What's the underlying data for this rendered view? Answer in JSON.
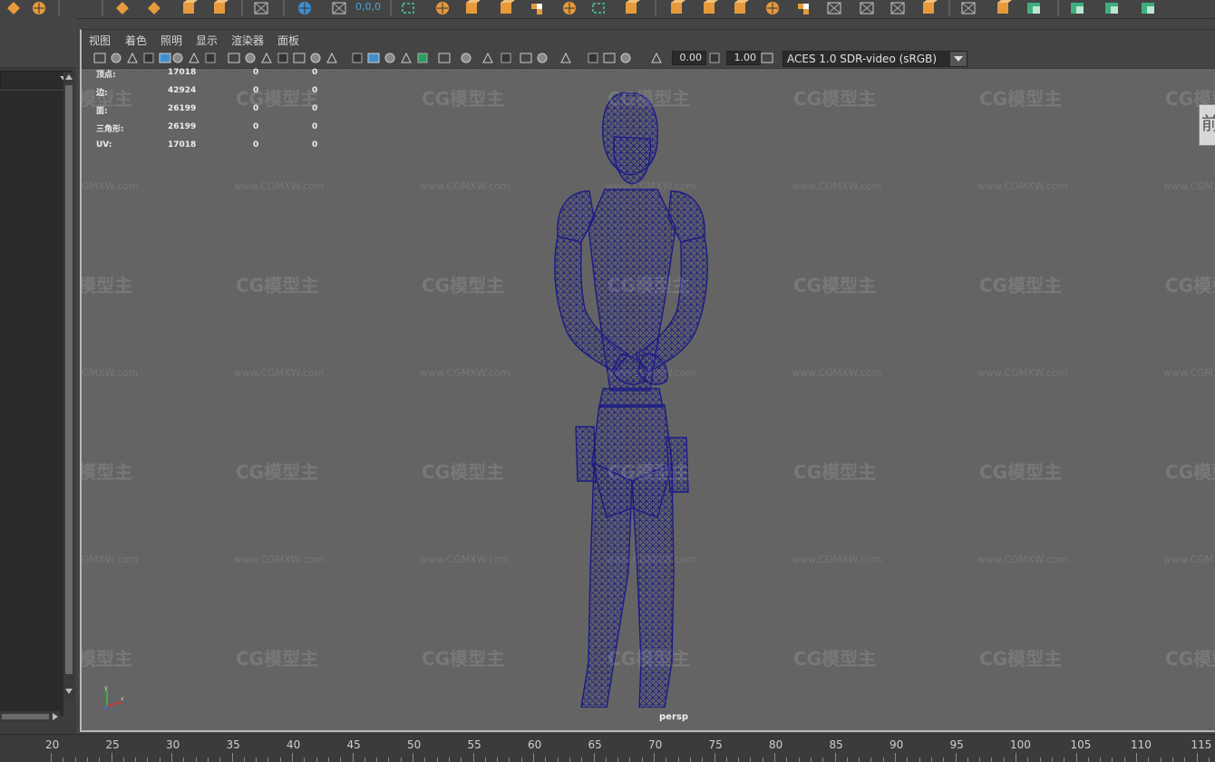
{
  "shelf": {
    "coords_readout": "0,0,0",
    "icons": [
      "diamond-shape-icon",
      "globe-shape-icon",
      "arrows-move-icon",
      "select-arrows-icon",
      "text-tool-icon",
      "picture-tool-icon",
      "grid-display-icon",
      "anchor-target-icon",
      "delete-x-icon",
      "lasso-select-icon",
      "render-sphere-icon",
      "cube-shape-icon",
      "cube-split-icon",
      "checker-cube-icon",
      "sphere-wire-icon",
      "edge-bracket-icon",
      "box-create-icon",
      "orange-block-icon",
      "cube-extrude-icon",
      "cube-bevel-icon",
      "texture-ball-icon",
      "uv-box-icon",
      "mirror-plane-icon",
      "triangle-mesh-icon",
      "mesh-cleanup-icon",
      "paint-brush-icon",
      "crop-box-icon",
      "sculpt-pen-icon",
      "green-shape-icon",
      "green-cylinder-icon",
      "green-cube-icon",
      "green-merge-icon"
    ]
  },
  "viewport": {
    "menu": [
      "视图",
      "着色",
      "照明",
      "显示",
      "渲染器",
      "面板"
    ],
    "toolbar": {
      "exposure_value": "0.00",
      "gamma_value": "1.00",
      "color_management": "ACES 1.0 SDR-video (sRGB)"
    },
    "hud": [
      {
        "label": "顶点:",
        "v1": "17018",
        "v2": "0",
        "v3": "0"
      },
      {
        "label": "边:",
        "v1": "42924",
        "v2": "0",
        "v3": "0"
      },
      {
        "label": "面:",
        "v1": "26199",
        "v2": "0",
        "v3": "0"
      },
      {
        "label": "三角形:",
        "v1": "26199",
        "v2": "0",
        "v3": "0"
      },
      {
        "label": "UV:",
        "v1": "17018",
        "v2": "0",
        "v3": "0"
      }
    ],
    "camera": "persp",
    "view_cube_text": "前",
    "axis": {
      "y": "y",
      "x": "x"
    }
  },
  "timeline": {
    "ticks": [
      "20",
      "25",
      "30",
      "35",
      "40",
      "45",
      "50",
      "55",
      "60",
      "65",
      "70",
      "75",
      "80",
      "85",
      "90",
      "95",
      "100",
      "105",
      "110",
      "115"
    ]
  },
  "watermark": {
    "logo": "CG模型主",
    "url": "www.CGMXW.com"
  },
  "colors": {
    "wireframe": "#1b1b86",
    "shelf_orange": "#e69a3c",
    "shelf_blue": "#3f8fcf",
    "shelf_green": "#3fae7e",
    "hud_text": "#ececec"
  }
}
